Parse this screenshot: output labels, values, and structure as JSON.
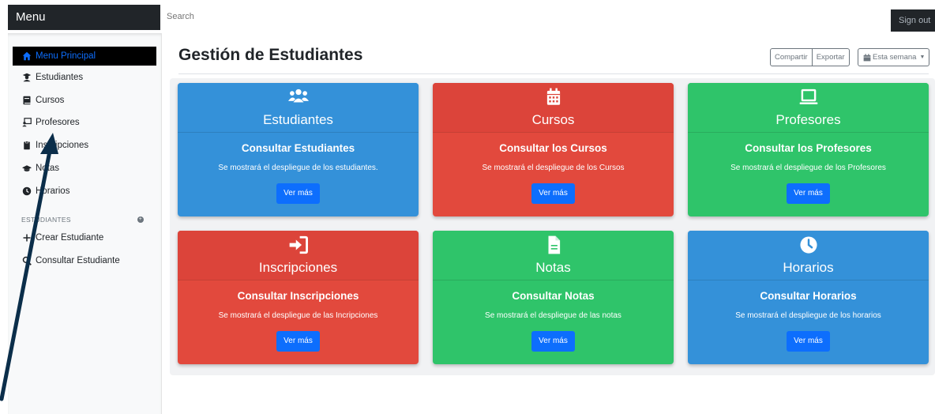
{
  "navbar": {
    "brand": "Menu",
    "search_placeholder": "Search",
    "signout": "Sign out"
  },
  "sidebar": {
    "items": [
      {
        "label": "Menu Principal",
        "icon": "home-icon"
      },
      {
        "label": "Estudiantes",
        "icon": "user-graduate-icon"
      },
      {
        "label": "Cursos",
        "icon": "book-icon"
      },
      {
        "label": "Profesores",
        "icon": "chalkboard-teacher-icon"
      },
      {
        "label": "Inscripciones",
        "icon": "clipboard-icon"
      },
      {
        "label": "Notas",
        "icon": "graduation-cap-icon"
      },
      {
        "label": "Horarios",
        "icon": "clock-icon"
      }
    ],
    "section_title": "ESTUDIANTES",
    "section_items": [
      {
        "label": "Crear Estudiante",
        "icon": "plus-icon"
      },
      {
        "label": "Consultar Estudiante",
        "icon": "search-icon"
      }
    ]
  },
  "main": {
    "title": "Gestión de Estudiantes",
    "toolbar": {
      "share": "Compartir",
      "export": "Exportar",
      "week": "Esta semana"
    }
  },
  "cards": [
    {
      "title": "Estudiantes",
      "subtitle": "Consultar Estudiantes",
      "desc": "Se mostrará el despliegue de los estudiantes.",
      "button": "Ver más",
      "color": "#3491d9",
      "icon": "users-icon"
    },
    {
      "title": "Cursos",
      "subtitle": "Consultar los Cursos",
      "desc": "Se mostrará el despliegue de los Cursos",
      "button": "Ver más",
      "color": "#e2493d",
      "icon": "calendar-icon"
    },
    {
      "title": "Profesores",
      "subtitle": "Consultar los Profesores",
      "desc": "Se mostrará el despliegue de los Profesores",
      "button": "Ver más",
      "color": "#2fc46a",
      "icon": "laptop-icon"
    },
    {
      "title": "Inscripciones",
      "subtitle": "Consultar Inscripciones",
      "desc": "Se mostrará el despliegue de las Incripciones",
      "button": "Ver más",
      "color": "#e2493d",
      "icon": "sign-in-icon"
    },
    {
      "title": "Notas",
      "subtitle": "Consultar Notas",
      "desc": "Se mostrará el despliegue de las notas",
      "button": "Ver más",
      "color": "#2fc46a",
      "icon": "file-icon"
    },
    {
      "title": "Horarios",
      "subtitle": "Consultar Horarios",
      "desc": "Se mostrará el despliegue de los horarios",
      "button": "Ver más",
      "color": "#3491d9",
      "icon": "clock-icon"
    }
  ]
}
